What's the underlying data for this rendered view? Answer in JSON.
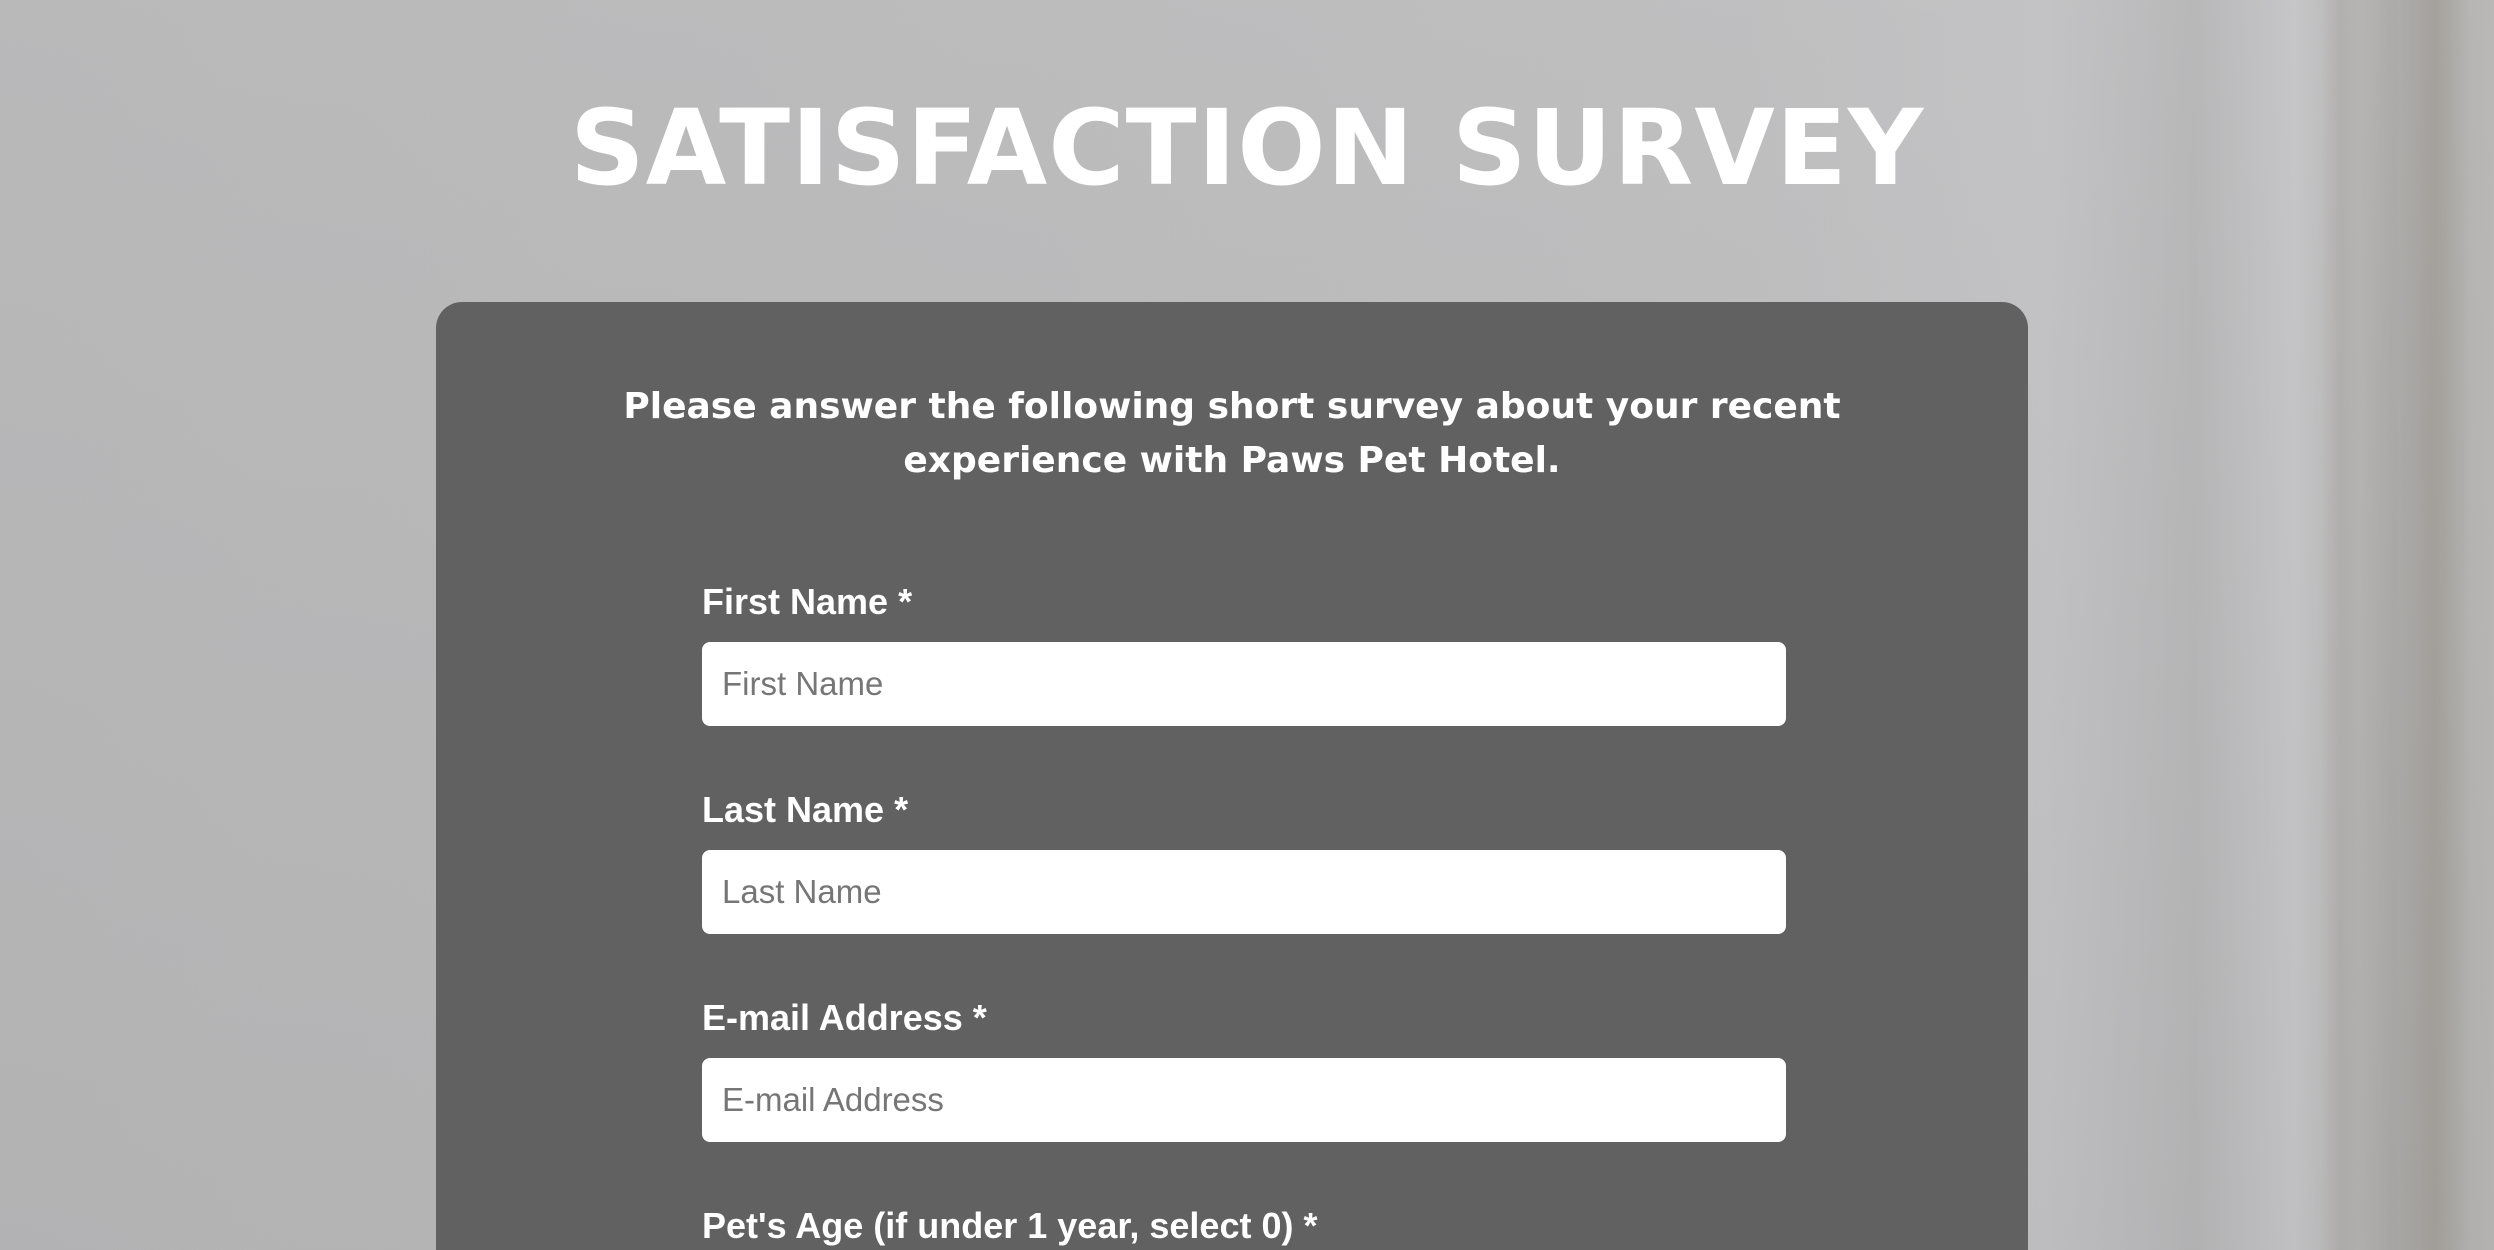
{
  "page": {
    "title": "SATISFACTION SURVEY"
  },
  "card": {
    "intro_line1": "Please answer the following short survey about your recent",
    "intro_line2": "experience with Paws Pet Hotel."
  },
  "form": {
    "first_name": {
      "label": "First Name *",
      "placeholder": "First Name",
      "value": ""
    },
    "last_name": {
      "label": "Last Name *",
      "placeholder": "Last Name",
      "value": ""
    },
    "email": {
      "label": "E-mail Address *",
      "placeholder": "E-mail Address",
      "value": ""
    },
    "pet_age": {
      "label": "Pet's Age (if under 1 year, select 0) *"
    }
  },
  "colors": {
    "card_background": "#616161",
    "text": "#ffffff",
    "input_background": "#ffffff",
    "placeholder": "#767676"
  }
}
